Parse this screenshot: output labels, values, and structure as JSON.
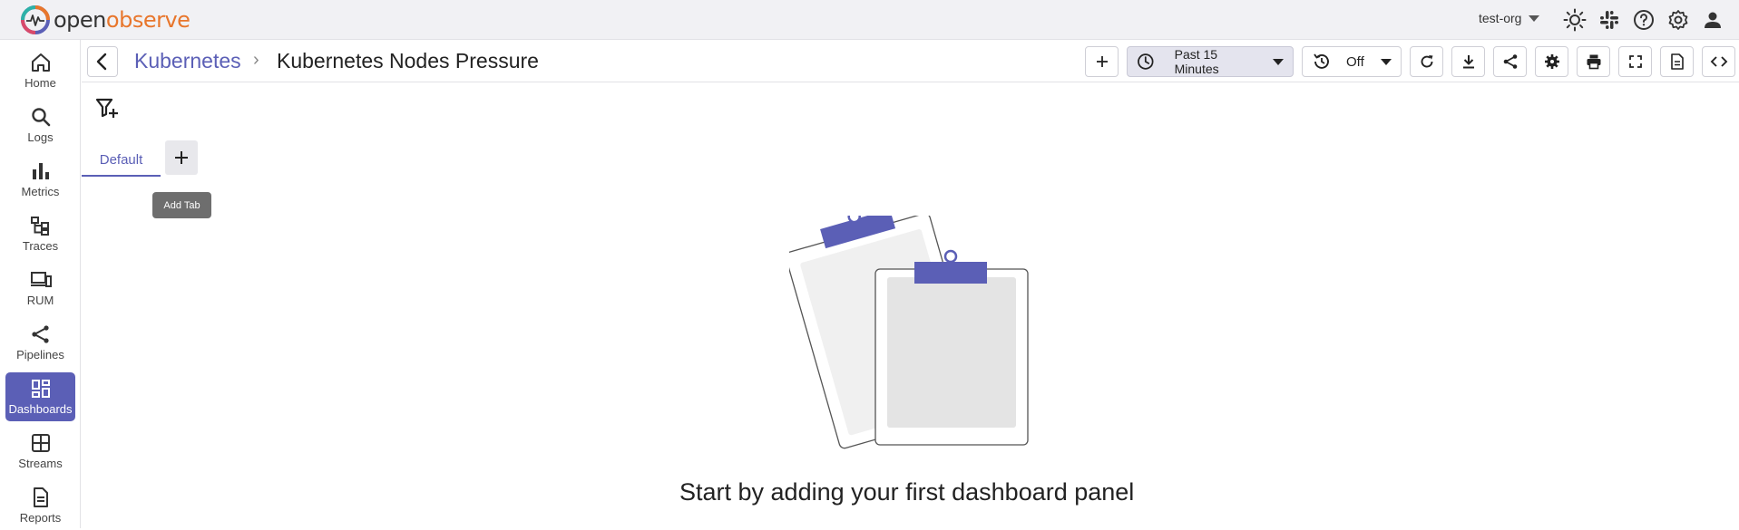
{
  "app": {
    "logo_text_primary": "open",
    "logo_text_accent": "observe",
    "org_selector": "test-org",
    "colors": {
      "accent": "#5b5fb6",
      "logo_accent": "#e8762c",
      "active_nav_bg": "#5b5fb6"
    }
  },
  "top_icons": [
    "sun-icon",
    "slack-icon",
    "help-icon",
    "settings-icon",
    "user-icon"
  ],
  "sidebar": {
    "items": [
      {
        "label": "Home",
        "icon": "home-icon",
        "active": false
      },
      {
        "label": "Logs",
        "icon": "search-icon",
        "active": false
      },
      {
        "label": "Metrics",
        "icon": "bar-chart-icon",
        "active": false
      },
      {
        "label": "Traces",
        "icon": "traces-icon",
        "active": false
      },
      {
        "label": "RUM",
        "icon": "devices-icon",
        "active": false
      },
      {
        "label": "Pipelines",
        "icon": "pipelines-icon",
        "active": false
      },
      {
        "label": "Dashboards",
        "icon": "dashboard-icon",
        "active": true
      },
      {
        "label": "Streams",
        "icon": "grid-icon",
        "active": false
      },
      {
        "label": "Reports",
        "icon": "document-icon",
        "active": false
      }
    ]
  },
  "dashboard": {
    "folder": "Kubernetes",
    "separator": "›",
    "title": "Kubernetes Nodes Pressure",
    "time_range": "Past 15 Minutes",
    "auto_refresh": "Off",
    "toolbar_icons": [
      "add-panel-icon",
      "refresh-icon",
      "download-icon",
      "share-icon",
      "settings-icon",
      "print-icon",
      "fullscreen-icon",
      "export-icon",
      "code-icon"
    ]
  },
  "tabs": {
    "items": [
      {
        "label": "Default",
        "active": true
      }
    ],
    "add_tooltip": "Add Tab"
  },
  "empty_state": {
    "message": "Start by adding your first dashboard panel"
  }
}
